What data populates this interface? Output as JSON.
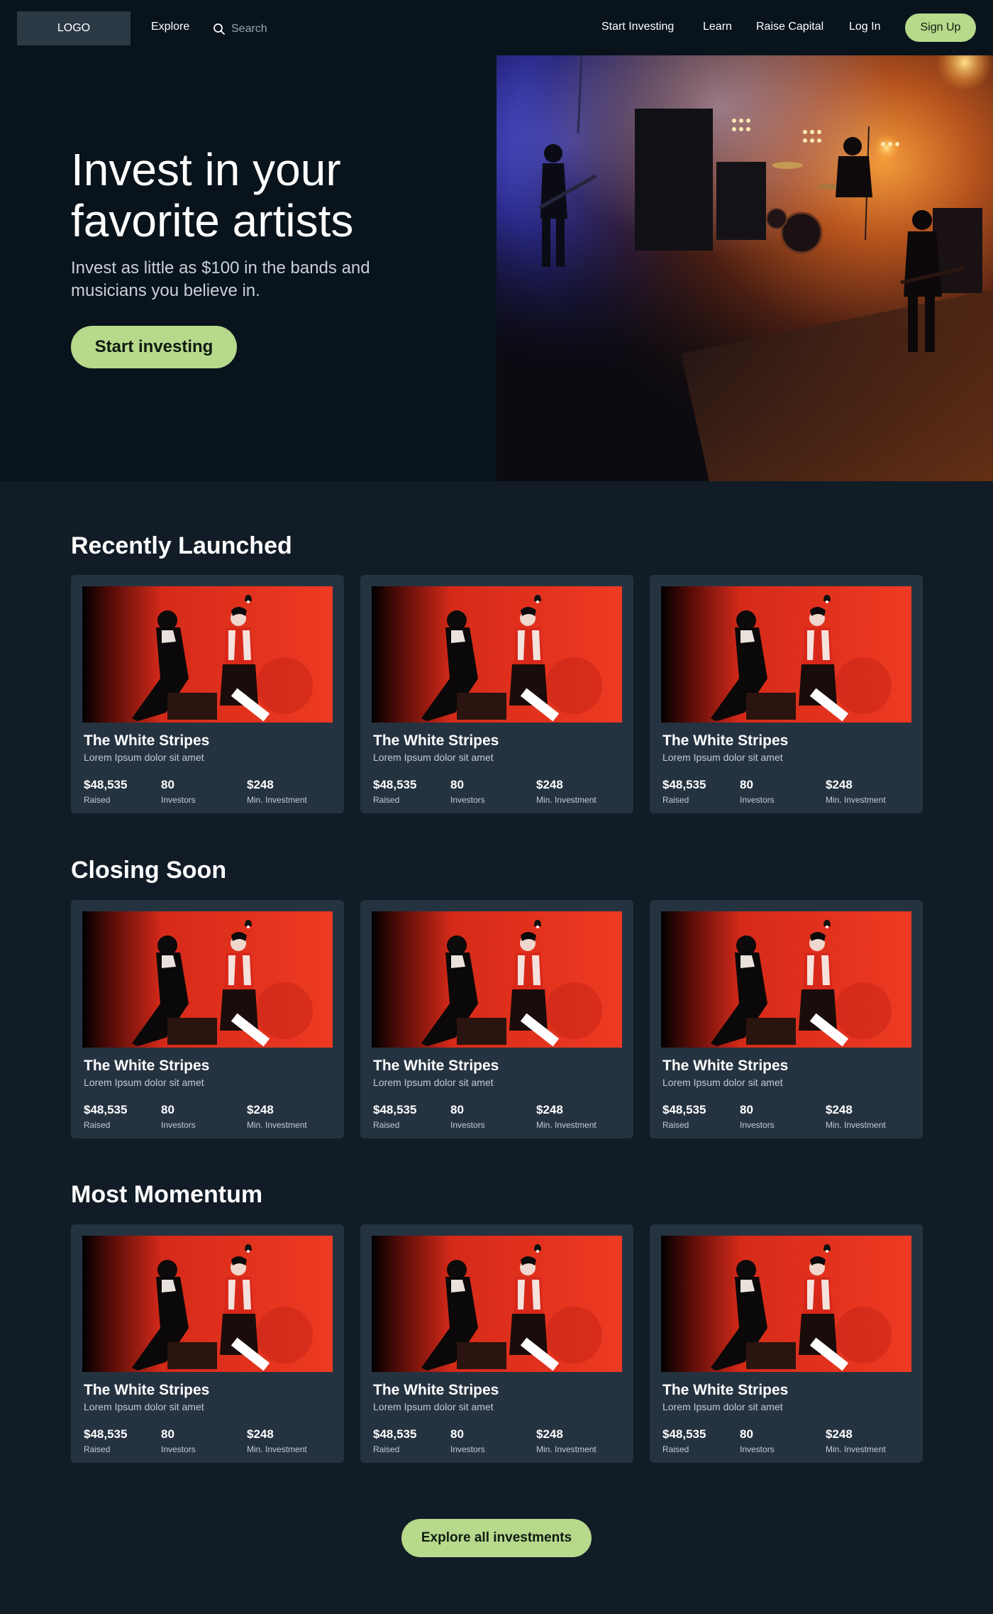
{
  "nav": {
    "logo": "LOGO",
    "explore": "Explore",
    "search_placeholder": "Search",
    "links": [
      "Start Investing",
      "Learn",
      "Raise Capital",
      "Log In"
    ],
    "signup": "Sign Up"
  },
  "hero": {
    "title": "Invest in your favorite artists",
    "subtitle": "Invest as little as $100 in the bands and musicians you believe in.",
    "cta": "Start investing"
  },
  "sections": [
    {
      "title": "Recently Launched",
      "cards": [
        {
          "name": "The White Stripes",
          "desc": "Lorem Ipsum dolor sit amet",
          "raised": "$48,535",
          "raised_label": "Raised",
          "investors": "80",
          "investors_label": "Investors",
          "min": "$248",
          "min_label": "Min. Investment"
        },
        {
          "name": "The White Stripes",
          "desc": "Lorem Ipsum dolor sit amet",
          "raised": "$48,535",
          "raised_label": "Raised",
          "investors": "80",
          "investors_label": "Investors",
          "min": "$248",
          "min_label": "Min. Investment"
        },
        {
          "name": "The White Stripes",
          "desc": "Lorem Ipsum dolor sit amet",
          "raised": "$48,535",
          "raised_label": "Raised",
          "investors": "80",
          "investors_label": "Investors",
          "min": "$248",
          "min_label": "Min. Investment"
        }
      ]
    },
    {
      "title": "Closing Soon",
      "cards": [
        {
          "name": "The White Stripes",
          "desc": "Lorem Ipsum dolor sit amet",
          "raised": "$48,535",
          "raised_label": "Raised",
          "investors": "80",
          "investors_label": "Investors",
          "min": "$248",
          "min_label": "Min. Investment"
        },
        {
          "name": "The White Stripes",
          "desc": "Lorem Ipsum dolor sit amet",
          "raised": "$48,535",
          "raised_label": "Raised",
          "investors": "80",
          "investors_label": "Investors",
          "min": "$248",
          "min_label": "Min. Investment"
        },
        {
          "name": "The White Stripes",
          "desc": "Lorem Ipsum dolor sit amet",
          "raised": "$48,535",
          "raised_label": "Raised",
          "investors": "80",
          "investors_label": "Investors",
          "min": "$248",
          "min_label": "Min. Investment"
        }
      ]
    },
    {
      "title": "Most Momentum",
      "cards": [
        {
          "name": "The White Stripes",
          "desc": "Lorem Ipsum dolor sit amet",
          "raised": "$48,535",
          "raised_label": "Raised",
          "investors": "80",
          "investors_label": "Investors",
          "min": "$248",
          "min_label": "Min. Investment"
        },
        {
          "name": "The White Stripes",
          "desc": "Lorem Ipsum dolor sit amet",
          "raised": "$48,535",
          "raised_label": "Raised",
          "investors": "80",
          "investors_label": "Investors",
          "min": "$248",
          "min_label": "Min. Investment"
        },
        {
          "name": "The White Stripes",
          "desc": "Lorem Ipsum dolor sit amet",
          "raised": "$48,535",
          "raised_label": "Raised",
          "investors": "80",
          "investors_label": "Investors",
          "min": "$248",
          "min_label": "Min. Investment"
        }
      ]
    }
  ],
  "explore_all": "Explore all investments",
  "icons": {
    "search": "search-icon"
  },
  "colors": {
    "nav_bg": "#09131c",
    "page_bg": "#111c26",
    "card_bg": "#253341",
    "accent": "#b6d98b",
    "album_red": "#e8301f"
  }
}
